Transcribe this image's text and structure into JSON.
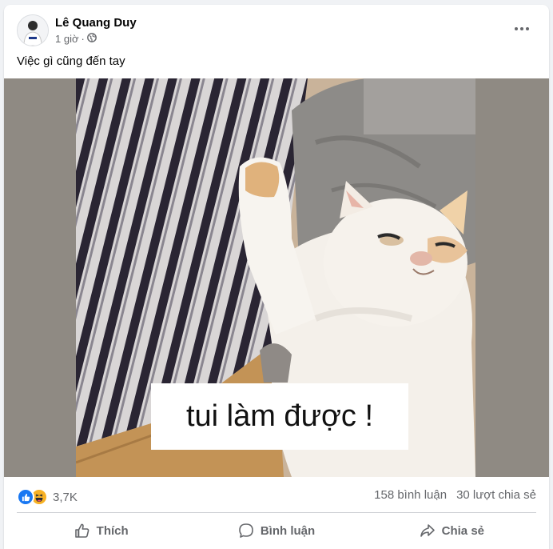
{
  "post": {
    "author": "Lê Quang Duy",
    "time": "1 giờ",
    "audience_icon": "globe-icon",
    "more_icon": "more-options-icon",
    "caption": "Việc gì cũng đến tay",
    "image_text": "tui làm được !",
    "reactions": {
      "types": [
        "like",
        "haha"
      ],
      "count": "3,7K"
    },
    "comments_count": "158 bình luận",
    "shares_count": "30 lượt chia sẻ"
  },
  "actions": {
    "like_label": "Thích",
    "comment_label": "Bình luận",
    "share_label": "Chia sẻ"
  },
  "colors": {
    "accent": "#1877f2",
    "secondary_text": "#65676b",
    "background": "#f0f2f5"
  }
}
